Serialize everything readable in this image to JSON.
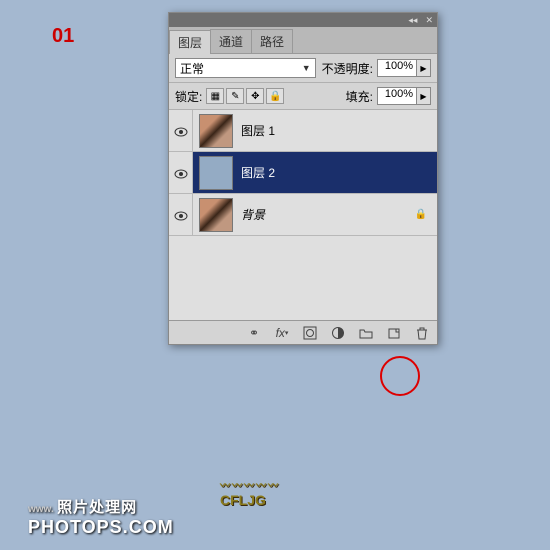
{
  "step_number": "01",
  "panel": {
    "tabs": {
      "layers": "图层",
      "channels": "通道",
      "paths": "路径"
    },
    "blend_mode": "正常",
    "opacity_label": "不透明度:",
    "opacity_value": "100%",
    "lock_label": "锁定:",
    "fill_label": "填充:",
    "fill_value": "100%",
    "layers": [
      {
        "name": "图层 1",
        "visible": true,
        "selected": false,
        "locked": false,
        "thumb": "photo"
      },
      {
        "name": "图层 2",
        "visible": true,
        "selected": true,
        "locked": false,
        "thumb": "solid"
      },
      {
        "name": "背景",
        "visible": true,
        "selected": false,
        "locked": true,
        "thumb": "photo",
        "italic": true
      }
    ]
  },
  "watermark": {
    "prefix": "www.",
    "cn": "照片处理网",
    "en": "PHOTOPS.COM",
    "logo": "CFLJG"
  }
}
